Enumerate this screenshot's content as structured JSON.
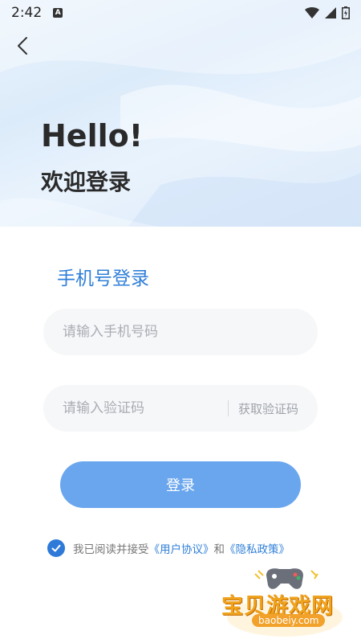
{
  "status_bar": {
    "time": "2:42",
    "notification_letter": "A"
  },
  "header": {
    "greeting": "Hello!",
    "subtitle": "欢迎登录"
  },
  "form": {
    "section_title": "手机号登录",
    "phone_placeholder": "请输入手机号码",
    "code_placeholder": "请输入验证码",
    "get_code_label": "获取验证码",
    "login_label": "登录"
  },
  "agreement": {
    "prefix": "我已阅读并接受",
    "user_agreement": "《用户协议》",
    "conjunction": "和",
    "privacy_policy": "《隐私政策》",
    "checked": true
  },
  "watermark": {
    "title": "宝贝游戏网",
    "url": "baobeiy.com"
  },
  "colors": {
    "accent": "#2f7fd8",
    "button": "#6aa6ee",
    "field_bg": "#f6f7f9",
    "watermark": "#f0a31c"
  }
}
